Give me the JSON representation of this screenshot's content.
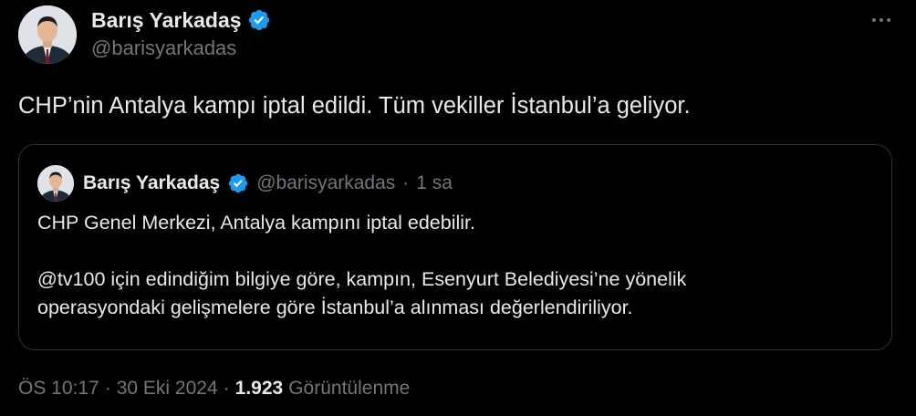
{
  "tweet": {
    "author": {
      "name": "Barış Yarkadaş",
      "handle": "@barisyarkadas",
      "verified": true
    },
    "text": "CHP’nin Antalya kampı iptal edildi. Tüm vekiller İstanbul’a geliyor.",
    "more_icon": "more-horizontal-icon",
    "quote": {
      "author": {
        "name": "Barış Yarkadaş",
        "handle": "@barisyarkadas",
        "verified": true
      },
      "separator": "·",
      "time": "1 sa",
      "paragraph1": "CHP Genel Merkezi, Antalya kampını iptal edebilir.",
      "paragraph2_line1": "@tv100 için edindiğim bilgiye göre, kampın, Esenyurt Belediyesi’ne yönelik",
      "paragraph2_line2": "operasyondaki gelişmelere göre  İstanbul’a alınması değerlendiriliyor."
    },
    "meta": {
      "time": "ÖS 10:17",
      "sep1": "·",
      "date": "30 Eki 2024",
      "sep2": "·",
      "views_count": "1.923",
      "views_label": "Görüntülenme"
    }
  },
  "colors": {
    "background": "#000000",
    "text_primary": "#e7e9ea",
    "text_secondary": "#71767b",
    "verified_blue": "#1d9bf0",
    "border": "#2f3336"
  }
}
